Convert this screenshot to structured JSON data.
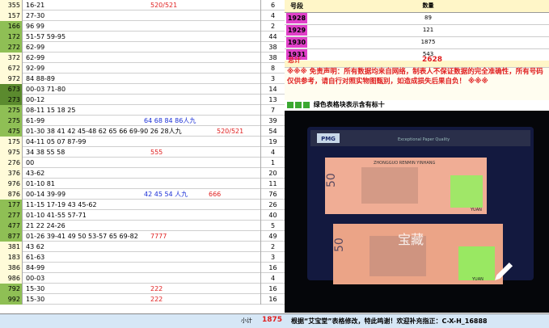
{
  "rows": [
    {
      "id": "355",
      "nums": "16-21",
      "note1": "",
      "note2": "520/521",
      "count": "6",
      "bg": "yellow"
    },
    {
      "id": "157",
      "nums": "27-30",
      "note1": "",
      "note2": "",
      "count": "4",
      "bg": "yellow"
    },
    {
      "id": "166",
      "nums": "96 99",
      "note1": "",
      "note2": "",
      "count": "2",
      "bg": "green"
    },
    {
      "id": "172",
      "nums": "51-57 59-95",
      "note1": "",
      "note2": "",
      "count": "44",
      "bg": "green"
    },
    {
      "id": "272",
      "nums": "62-99",
      "note1": "",
      "note2": "",
      "count": "38",
      "bg": "green"
    },
    {
      "id": "372",
      "nums": "62-99",
      "note1": "",
      "note2": "",
      "count": "38",
      "bg": "yellow"
    },
    {
      "id": "672",
      "nums": "92-99",
      "note1": "",
      "note2": "",
      "count": "8",
      "bg": "yellow"
    },
    {
      "id": "972",
      "nums": "84 88-89",
      "note1": "",
      "note2": "",
      "count": "3",
      "bg": "yellow"
    },
    {
      "id": "673",
      "nums": "00-03 71-80",
      "note1": "",
      "note2": "",
      "count": "14",
      "bg": "dgreen"
    },
    {
      "id": "273",
      "nums": "00-12",
      "note1": "",
      "note2": "",
      "count": "13",
      "bg": "dgreen"
    },
    {
      "id": "275",
      "nums": "08-11 15 18 25",
      "note1": "",
      "note2": "",
      "count": "7",
      "bg": "lgreen"
    },
    {
      "id": "275",
      "nums": "61-99",
      "note1": "64 68 84 86人九",
      "note2": "",
      "count": "39",
      "bg": "lgreen"
    },
    {
      "id": "475",
      "nums": "01-30 38 41 42 45-48 62 65 66 69-90 26 28人九",
      "note1": "",
      "note2": "520/521",
      "count": "54",
      "bg": "green"
    },
    {
      "id": "175",
      "nums": "04-11 05 07 87-99",
      "note1": "",
      "note2": "",
      "count": "19",
      "bg": "yellow"
    },
    {
      "id": "975",
      "nums": "34 38 55 58",
      "note1": "",
      "note2": "555",
      "count": "4",
      "bg": "yellow"
    },
    {
      "id": "276",
      "nums": "00",
      "note1": "",
      "note2": "",
      "count": "1",
      "bg": "yellow"
    },
    {
      "id": "376",
      "nums": "43-62",
      "note1": "",
      "note2": "",
      "count": "20",
      "bg": "yellow"
    },
    {
      "id": "976",
      "nums": "01-10 81",
      "note1": "",
      "note2": "",
      "count": "11",
      "bg": "yellow"
    },
    {
      "id": "876",
      "nums": "00-14 39-99",
      "note1": "42 45 54 人九",
      "note2": "666",
      "count": "76",
      "bg": "yellow"
    },
    {
      "id": "177",
      "nums": "11-15 17-19 43 45-62",
      "note1": "",
      "note2": "",
      "count": "26",
      "bg": "green"
    },
    {
      "id": "277",
      "nums": "01-10 41-55 57-71",
      "note1": "",
      "note2": "",
      "count": "40",
      "bg": "green"
    },
    {
      "id": "477",
      "nums": "21 22 24-26",
      "note1": "",
      "note2": "",
      "count": "5",
      "bg": "green"
    },
    {
      "id": "877",
      "nums": "01-26 39-41 49 50 53-57 65 69-82",
      "note1": "",
      "note2": "7777",
      "count": "49",
      "bg": "green"
    },
    {
      "id": "381",
      "nums": "43 62",
      "note1": "",
      "note2": "",
      "count": "2",
      "bg": "yellow"
    },
    {
      "id": "183",
      "nums": "61-63",
      "note1": "",
      "note2": "",
      "count": "3",
      "bg": "yellow"
    },
    {
      "id": "386",
      "nums": "84-99",
      "note1": "",
      "note2": "",
      "count": "16",
      "bg": "yellow"
    },
    {
      "id": "986",
      "nums": "00-03",
      "note1": "",
      "note2": "",
      "count": "4",
      "bg": "yellow"
    },
    {
      "id": "792",
      "nums": "15-30",
      "note1": "",
      "note2": "222",
      "count": "16",
      "bg": "green"
    },
    {
      "id": "992",
      "nums": "15-30",
      "note1": "",
      "note2": "222",
      "count": "16",
      "bg": "green"
    }
  ],
  "right": {
    "header_key": "号段",
    "header_val": "数量",
    "rows": [
      {
        "k": "1928",
        "v": "89"
      },
      {
        "k": "1929",
        "v": "121"
      },
      {
        "k": "1930",
        "v": "1875"
      },
      {
        "k": "1931",
        "v": "543"
      }
    ],
    "total_label": "总计",
    "total_value": "2628",
    "disclaimer": "※※※ 免责声明：所有数据均来自网络，制表人不保证数据的完全准确性，所有号码仅供参考，请自行对照实物图甄别，如造成损失后果自负！ ※※※",
    "legend": "绿色表格块表示含有标十"
  },
  "photo": {
    "pmg": "PMG",
    "grade_text": "Exceptional Paper Quality",
    "denom1": "50",
    "denom2": "50",
    "currency": "YUAN",
    "bank": "ZHONGGUO RENMIN YINHANG",
    "watermark": "宝藏",
    "edit_icon": "pencil-icon"
  },
  "footer": {
    "subtotal_label": "小计",
    "subtotal_value": "1875",
    "credit": "根据“艾宝堂”表格修改，特此鸣谢！欢迎补充指正：C-X-H_16888"
  },
  "colors": {
    "yellow_row": "#fffbd9",
    "green_row": "#8fbf55",
    "dark_green_row": "#5b8a2e",
    "light_green_row": "#d9e9c4",
    "magenta_key": "#e040c8",
    "blue_note": "#1a2fd6",
    "red_note": "#e02020"
  }
}
